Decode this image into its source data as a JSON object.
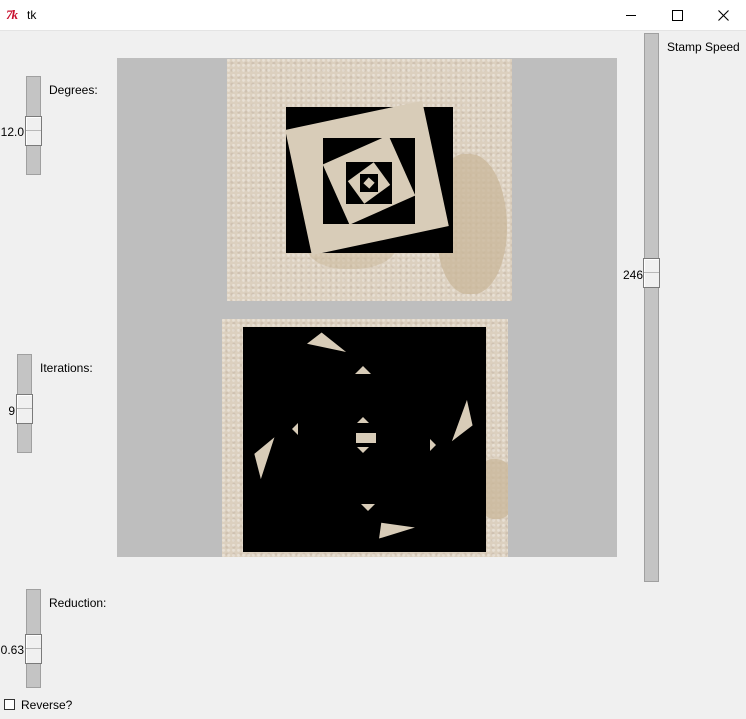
{
  "window": {
    "title": "tk"
  },
  "controls": {
    "degrees": {
      "label": "Degrees:",
      "value": "12.0"
    },
    "iterations": {
      "label": "Iterations:",
      "value": "9"
    },
    "reduction": {
      "label": "Reduction:",
      "value": "0.63"
    },
    "stamp_speed": {
      "label": "Stamp Speed",
      "value": "246"
    },
    "reverse": {
      "label": "Reverse?",
      "checked": false
    }
  },
  "colors": {
    "canvas_bg": "#bebebe",
    "window_bg": "#f0f0f0",
    "paper": "#dcd0bf",
    "tk_logo": "#c8102e"
  },
  "icons": [
    "tk-logo-icon",
    "minimize-icon",
    "maximize-icon",
    "close-icon"
  ]
}
